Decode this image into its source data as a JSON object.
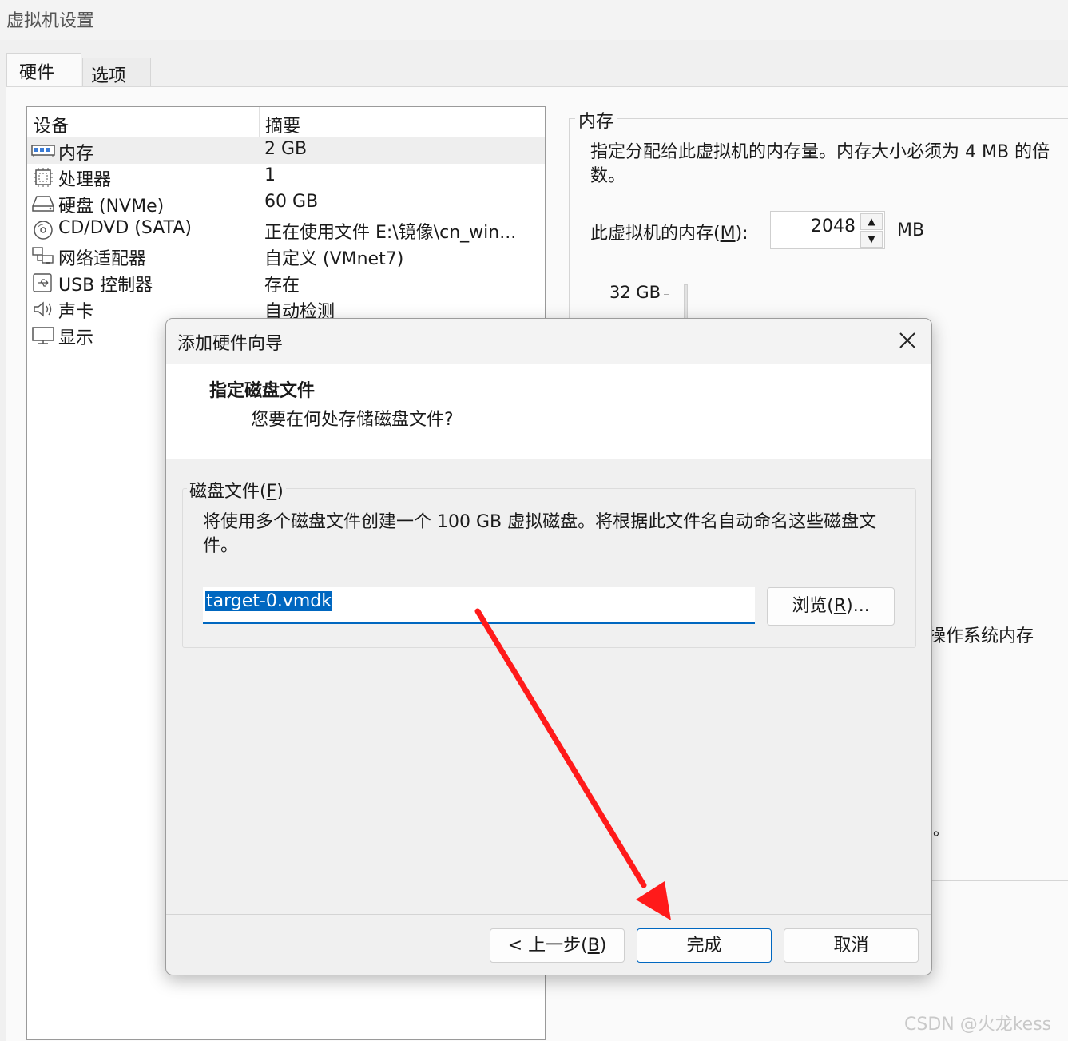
{
  "window": {
    "title": "虚拟机设置"
  },
  "tabs": [
    {
      "label": "硬件"
    },
    {
      "label": "选项"
    }
  ],
  "devices": {
    "col_device": "设备",
    "col_summary": "摘要",
    "rows": [
      {
        "name": "内存",
        "summary": "2 GB",
        "icon": "memory-icon"
      },
      {
        "name": "处理器",
        "summary": "1",
        "icon": "processor-icon"
      },
      {
        "name": "硬盘 (NVMe)",
        "summary": "60 GB",
        "icon": "hard-disk-icon"
      },
      {
        "name": "CD/DVD (SATA)",
        "summary": "正在使用文件 E:\\镜像\\cn_win...",
        "icon": "cd-dvd-icon"
      },
      {
        "name": "网络适配器",
        "summary": "自定义 (VMnet7)",
        "icon": "network-adapter-icon"
      },
      {
        "name": "USB 控制器",
        "summary": "存在",
        "icon": "usb-icon"
      },
      {
        "name": "声卡",
        "summary": "自动检测",
        "icon": "sound-card-icon"
      },
      {
        "name": "显示",
        "summary": "",
        "icon": "display-icon"
      }
    ]
  },
  "memory": {
    "group_title": "内存",
    "description": "指定分配给此虚拟机的内存量。内存大小必须为 4 MB 的倍数。",
    "label_prefix": "此虚拟机的内存(",
    "label_key": "M",
    "label_suffix": "):",
    "value": "2048",
    "unit": "MB",
    "scale_top": "32 GB",
    "partial_text_1": "操作系统内存",
    "partial_text_2": "。"
  },
  "dialog": {
    "title": "添加硬件向导",
    "heading": "指定磁盘文件",
    "subheading": "您要在何处存储磁盘文件?",
    "group_prefix": "磁盘文件(",
    "group_key": "F",
    "group_suffix": ")",
    "group_description": "将使用多个磁盘文件创建一个 100 GB 虚拟磁盘。将根据此文件名自动命名这些磁盘文件。",
    "file_name": "target-0.vmdk",
    "browse_prefix": "浏览(",
    "browse_key": "R",
    "browse_suffix": ")...",
    "back_prefix": "< 上一步(",
    "back_key": "B",
    "back_suffix": ")",
    "finish_label": "完成",
    "cancel_label": "取消"
  },
  "annotation": {
    "arrow_color": "#ff1a1a"
  },
  "watermark": "CSDN @火龙kess",
  "colors": {
    "accent": "#0067c0",
    "selection": "#0067c0"
  }
}
